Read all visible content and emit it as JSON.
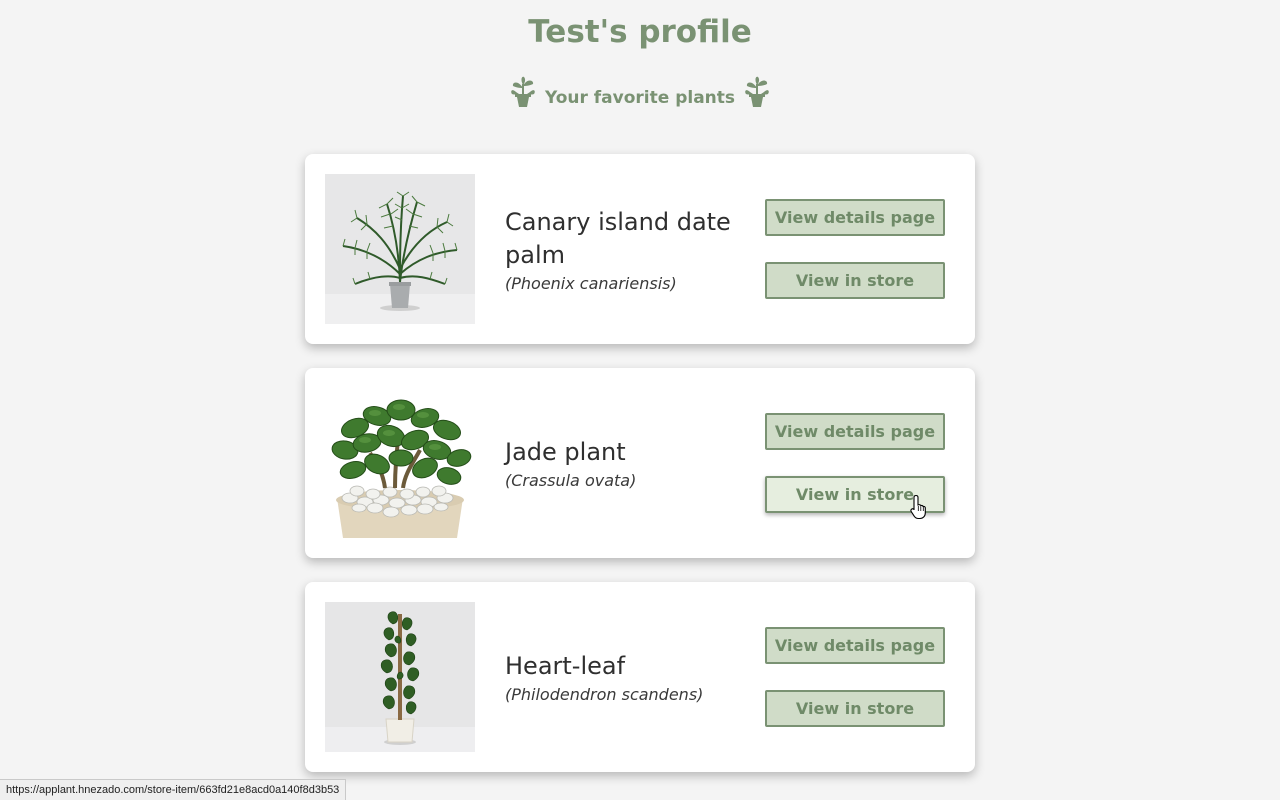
{
  "page": {
    "title": "Test's profile",
    "subtitle": "Your favorite plants"
  },
  "plants": [
    {
      "common_name": "Canary island date palm",
      "scientific_name": "(Phoenix canariensis)",
      "details_label": "View details page",
      "store_label": "View in store",
      "image_icon": "palm-plant-photo"
    },
    {
      "common_name": "Jade plant",
      "scientific_name": "(Crassula ovata)",
      "details_label": "View details page",
      "store_label": "View in store",
      "image_icon": "jade-plant-photo"
    },
    {
      "common_name": "Heart-leaf",
      "scientific_name": "(Philodendron scandens)",
      "details_label": "View details page",
      "store_label": "View in store",
      "image_icon": "heartleaf-plant-photo"
    }
  ],
  "status_bar": {
    "url": "https://applant.hnezado.com/store-item/663fd21e8acd0a140f8d3b53"
  },
  "colors": {
    "accent": "#7a9273",
    "button_bg": "#d0dcc8",
    "button_hover_bg": "#e6eedf",
    "page_bg": "#f4f4f4"
  }
}
